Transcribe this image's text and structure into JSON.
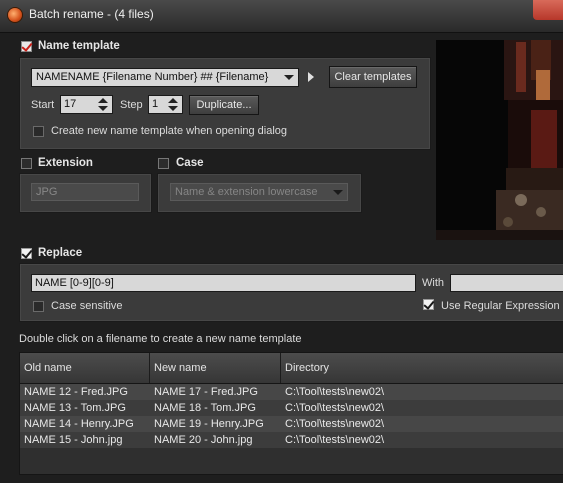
{
  "window": {
    "title": "Batch rename - (4 files)"
  },
  "name_template": {
    "label": "Name template",
    "checked": true,
    "template_value": "NAMENAME {Filename Number} ## {Filename}",
    "clear_button": "Clear templates",
    "start_label": "Start",
    "start_value": "17",
    "step_label": "Step",
    "step_value": "1",
    "duplicate_button": "Duplicate...",
    "create_new_label": "Create new name template when opening dialog",
    "create_new_checked": false
  },
  "extension": {
    "label": "Extension",
    "checked": false,
    "value": "JPG"
  },
  "case": {
    "label": "Case",
    "checked": false,
    "value": "Name & extension lowercase"
  },
  "replace": {
    "label": "Replace",
    "checked": true,
    "find_value": "NAME [0-9][0-9]",
    "with_label": "With",
    "with_value": "",
    "case_sensitive_label": "Case sensitive",
    "case_sensitive_checked": false,
    "regex_label": "Use Regular Expression",
    "regex_checked": true
  },
  "hint": "Double click on a filename to create a new name template",
  "table": {
    "columns": [
      "Old name",
      "New name",
      "Directory"
    ],
    "rows": [
      {
        "old": "NAME 12 - Fred.JPG",
        "new": "NAME 17  - Fred.JPG",
        "dir": "C:\\Tool\\tests\\new02\\"
      },
      {
        "old": "NAME 13 - Tom.JPG",
        "new": "NAME 18  - Tom.JPG",
        "dir": "C:\\Tool\\tests\\new02\\"
      },
      {
        "old": "NAME 14 - Henry.JPG",
        "new": "NAME 19  - Henry.JPG",
        "dir": "C:\\Tool\\tests\\new02\\"
      },
      {
        "old": "NAME 15 - John.jpg",
        "new": "NAME 20  - John.jpg",
        "dir": "C:\\Tool\\tests\\new02\\"
      }
    ]
  },
  "colors": {
    "background": "#1e1e1e",
    "panel": "#3b3b3b",
    "row_even": "#474747",
    "row_odd": "#3c3c3c",
    "accent_check": "#c8201a"
  }
}
